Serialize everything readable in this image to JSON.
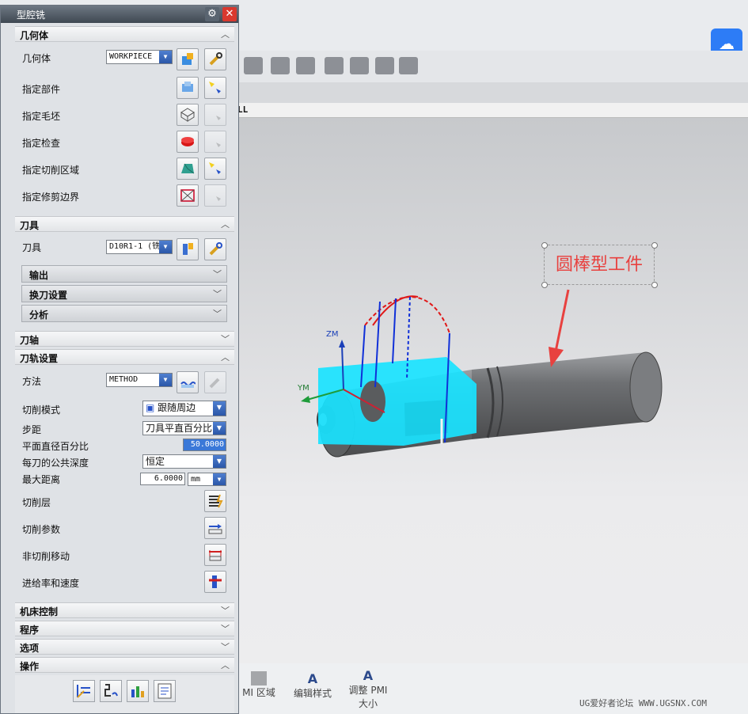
{
  "dialog": {
    "title": "型腔铣",
    "sections": {
      "geometry": "几何体",
      "tool": "刀具",
      "tool_axis": "刀轴",
      "path_settings": "刀轨设置",
      "machine_control": "机床控制",
      "program": "程序",
      "options": "选项",
      "actions": "操作"
    },
    "geometry": {
      "geometry_label": "几何体",
      "geometry_value": "WORKPIECE",
      "part_label": "指定部件",
      "blank_label": "指定毛坯",
      "check_label": "指定检查",
      "cut_area_label": "指定切削区域",
      "trim_label": "指定修剪边界"
    },
    "tool": {
      "tool_label": "刀具",
      "tool_value": "D10R1-1 (铣",
      "output": "输出",
      "tool_change": "换刀设置",
      "analysis": "分析"
    },
    "path": {
      "method_label": "方法",
      "method_value": "METHOD",
      "cut_pattern_label": "切削模式",
      "cut_pattern_value": "跟随周边",
      "stepover_label": "步距",
      "stepover_value": "刀具平直百分比",
      "percent_label": "平面直径百分比",
      "percent_value": "50.0000",
      "depth_label": "每刀的公共深度",
      "depth_value": "恒定",
      "max_dist_label": "最大距离",
      "max_dist_value": "6.0000",
      "max_dist_unit": "mm",
      "cut_levels_label": "切削层",
      "cut_params_label": "切削参数",
      "non_cut_label": "非切削移动",
      "feeds_label": "进给率和速度"
    }
  },
  "viewport": {
    "tab_text": "LL",
    "annotation": "圆棒型工件",
    "axis_zm": "ZM",
    "axis_ym": "YM"
  },
  "bottom_toolbar": {
    "pmi_region": "MI 区域",
    "edit_style": "编辑样式",
    "adjust_pmi": "调整 PMI",
    "adjust_size": "大小"
  },
  "watermark": "UG爱好者论坛 WWW.UGSNX.COM",
  "colors": {
    "workpiece": "#8a8b8d",
    "blank_box": "#00e5ff",
    "annotation": "#e8413f",
    "accent": "#2d7cf6"
  }
}
